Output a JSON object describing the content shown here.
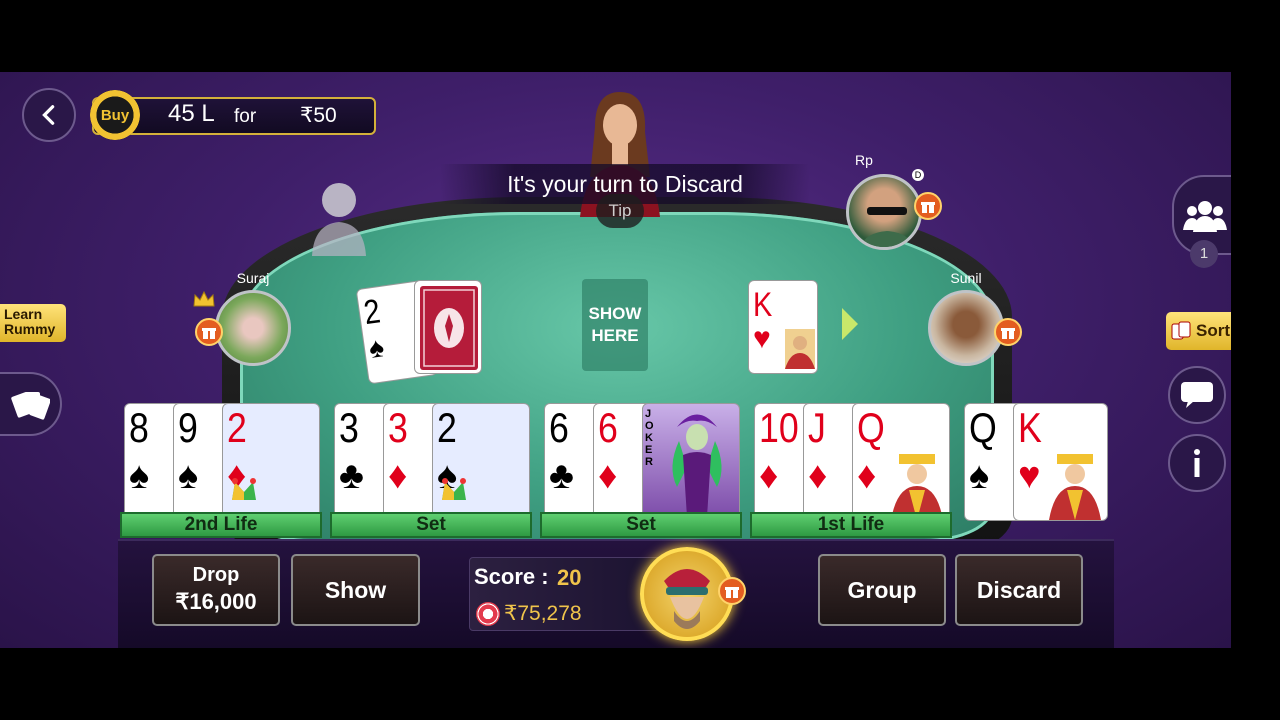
{
  "top_bar": {
    "buy_label": "Buy",
    "buy_amount": "45 L",
    "for_label": "for",
    "price": "₹50"
  },
  "table": {
    "turn_message": "It's your turn to Discard",
    "tip_label": "Tip",
    "show_here_label": "SHOW HERE",
    "open_card": {
      "rank": "2",
      "suit": "♠"
    },
    "discard_card": {
      "rank": "K",
      "suit": "♥"
    }
  },
  "players": {
    "left": {
      "name": "Suraj"
    },
    "top_right": {
      "name": "Rp",
      "badge": "D"
    },
    "right": {
      "name": "Sunil"
    }
  },
  "side_buttons": {
    "learn_rummy": "Learn Rummy",
    "sort": "Sort",
    "players_count": "1"
  },
  "hand": {
    "groups": [
      {
        "label": "2nd Life",
        "cards": [
          {
            "rank": "8",
            "suit": "♠",
            "color": "black"
          },
          {
            "rank": "9",
            "suit": "♠",
            "color": "black"
          },
          {
            "rank": "2",
            "suit": "♦",
            "color": "red",
            "joker": true
          }
        ]
      },
      {
        "label": "Set",
        "cards": [
          {
            "rank": "3",
            "suit": "♣",
            "color": "black"
          },
          {
            "rank": "3",
            "suit": "♦",
            "color": "red"
          },
          {
            "rank": "2",
            "suit": "♠",
            "color": "black",
            "joker": true
          }
        ]
      },
      {
        "label": "Set",
        "cards": [
          {
            "rank": "6",
            "suit": "♣",
            "color": "black"
          },
          {
            "rank": "6",
            "suit": "♦",
            "color": "red"
          },
          {
            "rank": "JOKER",
            "suit": "",
            "color": "black"
          }
        ]
      },
      {
        "label": "1st Life",
        "cards": [
          {
            "rank": "10",
            "suit": "♦",
            "color": "red"
          },
          {
            "rank": "J",
            "suit": "♦",
            "color": "red"
          },
          {
            "rank": "Q",
            "suit": "♦",
            "color": "red"
          }
        ]
      },
      {
        "label": "",
        "cards": [
          {
            "rank": "Q",
            "suit": "♠",
            "color": "black"
          },
          {
            "rank": "K",
            "suit": "♥",
            "color": "red"
          }
        ]
      }
    ]
  },
  "bottom": {
    "drop_label": "Drop",
    "drop_amount": "₹16,000",
    "show_label": "Show",
    "score_label": "Score :",
    "score_value": "20",
    "chips": "₹75,278",
    "group_label": "Group",
    "discard_label": "Discard"
  },
  "colors": {
    "felt": "#3f9f82",
    "background": "#3f1f6a",
    "gold": "#f0c44b",
    "group_label": "#2e9a43"
  }
}
